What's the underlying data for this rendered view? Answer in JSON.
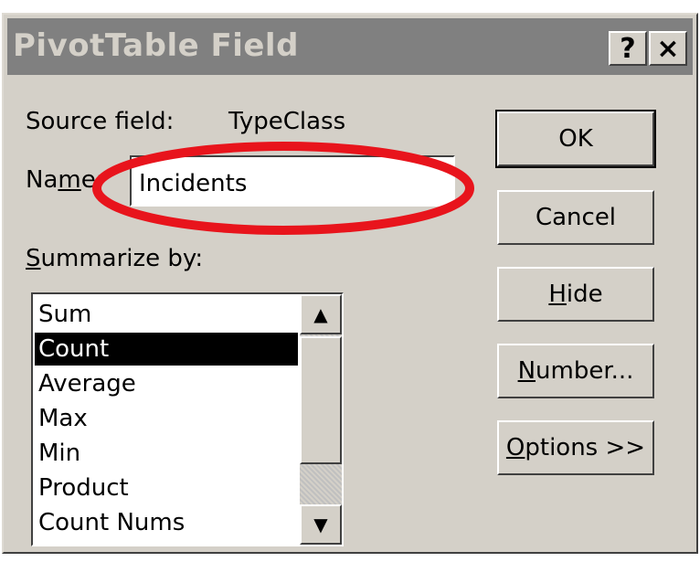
{
  "dialog": {
    "title": "PivotTable Field",
    "help_label": "?",
    "close_label": "×"
  },
  "source_field": {
    "label": "Source field:",
    "value": "TypeClass"
  },
  "name_field": {
    "label_before": "Na",
    "label_mnemonic": "m",
    "label_after": "e:",
    "value": "Incidents"
  },
  "summarize": {
    "label_mnemonic": "S",
    "label_rest": "ummarize by:",
    "options": [
      "Sum",
      "Count",
      "Average",
      "Max",
      "Min",
      "Product",
      "Count Nums"
    ],
    "selected": "Count",
    "scroll_up_icon": "▲",
    "scroll_down_icon": "▼"
  },
  "buttons": {
    "ok": "OK",
    "cancel": "Cancel",
    "hide_mnemonic": "H",
    "hide_rest": "ide",
    "number_mnemonic": "N",
    "number_rest": "umber...",
    "options_mnemonic": "O",
    "options_rest": "ptions >>"
  },
  "colors": {
    "dialog_bg": "#d4d0c8",
    "titlebar_inactive": "#808080",
    "highlight_oval": "#e8141c",
    "selection": "#000000"
  }
}
